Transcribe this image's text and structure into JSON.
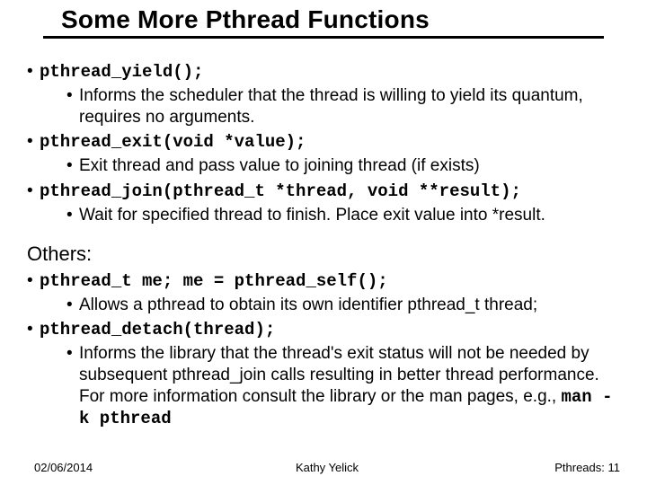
{
  "title": "Some More Pthread Functions",
  "bullets": {
    "yield_code": "pthread_yield();",
    "yield_desc": " Informs the scheduler that the thread is willing to yield its quantum, requires no arguments.",
    "exit_code": "pthread_exit(void *value);",
    "exit_desc": "Exit thread and pass value to joining thread (if exists)",
    "join_code": "pthread_join(pthread_t *thread, void **result);",
    "join_desc": "Wait for specified thread to finish.  Place exit value into *result."
  },
  "others_label": "Others:",
  "others": {
    "self_code": "pthread_t me; me = pthread_self();",
    "self_desc": "Allows a pthread to obtain its own identifier pthread_t thread;",
    "detach_code": "pthread_detach(thread);",
    "detach_desc_part1": "Informs the library that the thread's exit status will not be needed by subsequent pthread_join calls resulting in better thread performance. For more information consult the library or the man pages, e.g., ",
    "detach_desc_code": "man -k pthread"
  },
  "footer": {
    "date": "02/06/2014",
    "author": "Kathy Yelick",
    "page": "Pthreads: 11"
  }
}
